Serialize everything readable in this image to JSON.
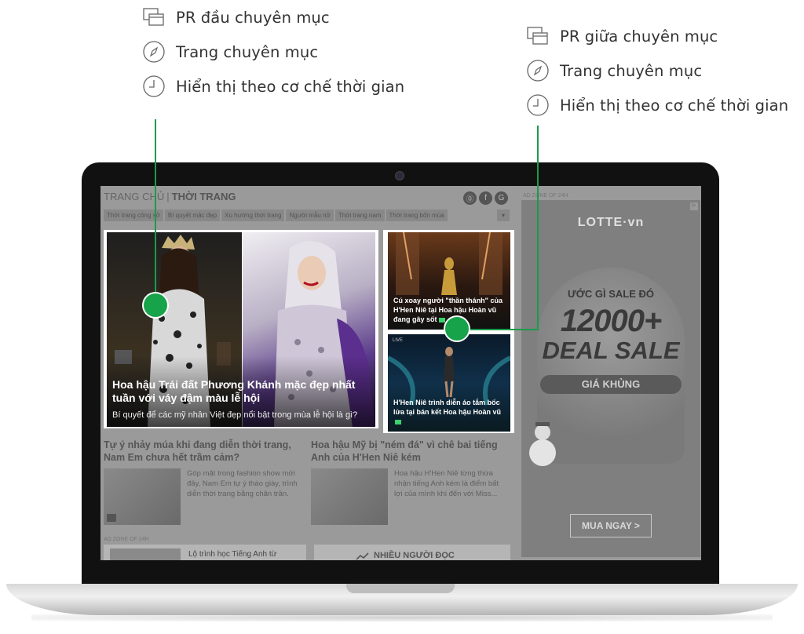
{
  "legend_left": {
    "items": [
      {
        "icon": "window-stack-icon",
        "text": "PR đầu chuyên mục"
      },
      {
        "icon": "compass-icon",
        "text": "Trang chuyên mục"
      },
      {
        "icon": "clock-icon",
        "text": "Hiển thị theo cơ chế thời gian"
      }
    ]
  },
  "legend_right": {
    "items": [
      {
        "icon": "window-stack-icon",
        "text": "PR giữa chuyên mục"
      },
      {
        "icon": "compass-icon",
        "text": "Trang chuyên mục"
      },
      {
        "icon": "clock-icon",
        "text": "Hiển thị theo cơ chế thời gian"
      }
    ]
  },
  "colors": {
    "accent": "#16a34a"
  },
  "site": {
    "breadcrumb_home": "TRANG CHỦ",
    "breadcrumb_section": "THỜI TRANG",
    "ad_zone_label": "AD ZONE OF 24H",
    "subnav": [
      "Thời trang công sở",
      "Bí quyết mặc đẹp",
      "Xu hướng thời trang",
      "Người mẫu nữ",
      "Thời trang nam",
      "Thời trang bốn mùa"
    ],
    "feature": {
      "title": "Hoa hậu Trái đất Phương Khánh mặc đẹp nhất tuần với váy đậm màu lễ hội",
      "subtitle": "Bí quyết để các mỹ nhân Việt đẹp nổi bật trong mùa lễ hội là gì?"
    },
    "side_cards": [
      {
        "title": "Cú xoay người \"thần thánh\" của H'Hen Niê tại Hoa hậu Hoàn vũ đang gây sốt"
      },
      {
        "title": "H'Hen Niê trình diễn áo tắm bốc lửa tại bán kết Hoa hậu Hoàn vũ",
        "live": "LIVE"
      }
    ],
    "articles": [
      {
        "title": "Tự ý nhảy múa khi đang diễn thời trang, Nam Em chưa hết trầm cảm?",
        "desc": "Góp mặt trong fashion show mới đây, Nam Em tự ý tháo giày, trình diễn thời trang bằng chân trần."
      },
      {
        "title": "Hoa hậu Mỹ bị \"ném đá\" vì chê bai tiếng Anh của H'Hen Niê kém",
        "desc": "Hoa hậu H'Hen Niê từng thừa nhận tiếng Anh kém là điểm bất lợi của mình khi đến với Miss..."
      }
    ],
    "bottom_left_title": "Lộ trình học Tiếng Anh từ",
    "bottom_right_title": "NHIỀU NGƯỜI ĐỌC",
    "ad": {
      "logo": "LOTTE·vn",
      "line1": "ƯỚC GÌ SALE ĐÓ",
      "big": "12000+",
      "deal": "DEAL SALE",
      "price": "GIÁ KHỦNG",
      "button": "MUA NGAY >"
    }
  }
}
